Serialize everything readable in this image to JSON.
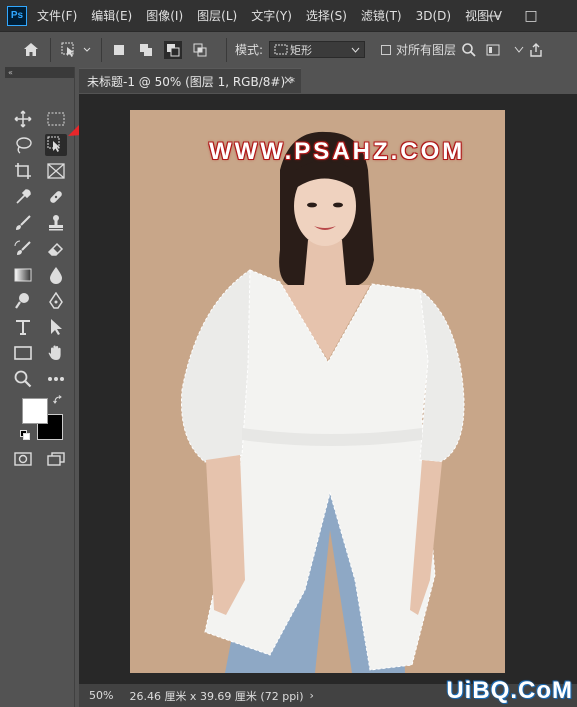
{
  "app": {
    "logo_text": "Ps"
  },
  "menu": [
    "文件(F)",
    "编辑(E)",
    "图像(I)",
    "图层(L)",
    "文字(Y)",
    "选择(S)",
    "滤镜(T)",
    "3D(D)",
    "视图(V"
  ],
  "window_controls": {
    "minimize": "—",
    "maximize": "□"
  },
  "options_bar": {
    "mode_label": "模式:",
    "mode_value": "矩形",
    "sample_all_layers": "对所有图层"
  },
  "toolbar": {
    "collapse": "«"
  },
  "document_tab": {
    "title": "未标题-1 @ 50% (图层 1, RGB/8#) *",
    "close": "×"
  },
  "canvas": {
    "watermark": "WWW.PSAHZ.COM",
    "background_color": "#c8a689"
  },
  "status_bar": {
    "zoom": "50%",
    "doc_info": "26.46 厘米 x 39.69 厘米 (72 ppi)",
    "arrow": "›"
  },
  "corner_watermark": "UiBQ.CoM",
  "colors": {
    "foreground": "#ffffff",
    "background": "#000000",
    "accent_arrow": "#e8262a"
  }
}
